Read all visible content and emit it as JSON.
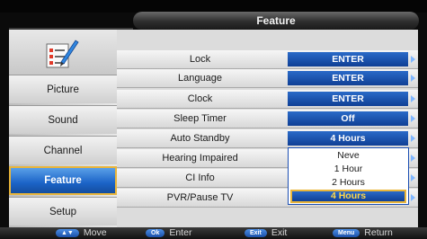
{
  "header": {
    "title": "Feature"
  },
  "sidebar": {
    "logo_icon": "settings-checklist-icon",
    "items": [
      {
        "label": "Picture",
        "active": false
      },
      {
        "label": "Sound",
        "active": false
      },
      {
        "label": "Channel",
        "active": false
      },
      {
        "label": "Feature",
        "active": true
      },
      {
        "label": "Setup",
        "active": false
      }
    ]
  },
  "menu": {
    "rows": [
      {
        "label": "Lock",
        "value": "ENTER"
      },
      {
        "label": "Language",
        "value": "ENTER"
      },
      {
        "label": "Clock",
        "value": "ENTER"
      },
      {
        "label": "Sleep Timer",
        "value": "Off"
      },
      {
        "label": "Auto Standby",
        "value": "4 Hours"
      },
      {
        "label": "Hearing Impaired",
        "value": ""
      },
      {
        "label": "CI Info",
        "value": ""
      },
      {
        "label": "PVR/Pause TV",
        "value": ""
      }
    ]
  },
  "dropdown": {
    "options": [
      "Neve",
      "1 Hour",
      "2 Hours",
      "4 Hours"
    ],
    "selected": "4 Hours"
  },
  "footer": {
    "hints": [
      {
        "key": "▲▼",
        "label": "Move"
      },
      {
        "key": "Ok",
        "label": "Enter"
      },
      {
        "key": "Exit",
        "label": "Exit"
      },
      {
        "key": "Menu",
        "label": "Return"
      }
    ]
  },
  "colors": {
    "accent_blue": "#1b63c7",
    "highlight_border": "#e9b53a",
    "selected_text": "#ffd84a"
  }
}
